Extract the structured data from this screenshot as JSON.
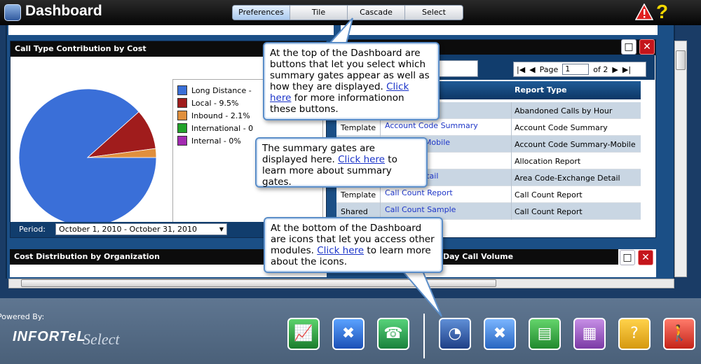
{
  "header": {
    "title": "Dashboard",
    "toolbar": [
      "Preferences",
      "Tile",
      "Cascade",
      "Select"
    ]
  },
  "gate_call_type": {
    "title": "Call Type Contribution by Cost",
    "legend": [
      {
        "label": "Long Distance -",
        "color": "#3a6fd8"
      },
      {
        "label": "Local - 9.5%",
        "color": "#a01c1c"
      },
      {
        "label": "Inbound - 2.1%",
        "color": "#e08f3c"
      },
      {
        "label": "International - 0",
        "color": "#22a32a"
      },
      {
        "label": "Internal - 0%",
        "color": "#a32ab1"
      }
    ],
    "period_label": "Period:",
    "period_value": "October 1, 2010 - October 31, 2010"
  },
  "chart_data": {
    "type": "pie",
    "labels": [
      "Long Distance",
      "Local",
      "Inbound",
      "International",
      "Internal"
    ],
    "values": [
      88.4,
      9.5,
      2.1,
      0,
      0
    ],
    "colors": [
      "#3a6fd8",
      "#a01c1c",
      "#e08f3c",
      "#22a32a",
      "#a32ab1"
    ]
  },
  "gate_reports": {
    "pager": {
      "page_label": "Page",
      "page_value": "1",
      "of_label": "of 2"
    },
    "col2_header": "Report Type",
    "rows": [
      {
        "c0": "",
        "c1": "lls by Hour",
        "c2": "Abandoned Calls by Hour"
      },
      {
        "c0": "Template",
        "c1": "Account Code Summary",
        "c2": "Account Code Summary"
      },
      {
        "c0": "",
        "c1": "Summary-Mobile",
        "c2": "Account Code Summary-Mobile"
      },
      {
        "c0": "",
        "c1": "ort",
        "c2": "Allocation Report"
      },
      {
        "c0": "",
        "c1": "change Detail",
        "c2": "Area Code-Exchange Detail"
      },
      {
        "c0": "Template",
        "c1": "Call Count Report",
        "c2": "Call Count Report"
      },
      {
        "c0": "Shared",
        "c1": "Call Count Sample",
        "c2": "Call Count Report"
      }
    ]
  },
  "gate_cost": {
    "title": "Cost Distribution by Organization"
  },
  "gate_volume": {
    "title": "Day Call Volume"
  },
  "footer": {
    "powered": "Powered By:",
    "brand": "INFORTeL",
    "brand_sub": "Select"
  },
  "callouts": {
    "top": {
      "text": "At the top of the Dashboard are buttons that let you select which summary gates appear as well as how they are displayed. ",
      "link": "Click here",
      "after": " for more informationon these buttons."
    },
    "mid": {
      "text": "The summary gates are displayed here. ",
      "link": "Click here",
      "after": " to learn more about summary gates."
    },
    "bottom": {
      "text": "At the bottom of the Dashboard are icons that let you access other modules. ",
      "link": "Click here",
      "after": " to learn more about the icons."
    }
  }
}
